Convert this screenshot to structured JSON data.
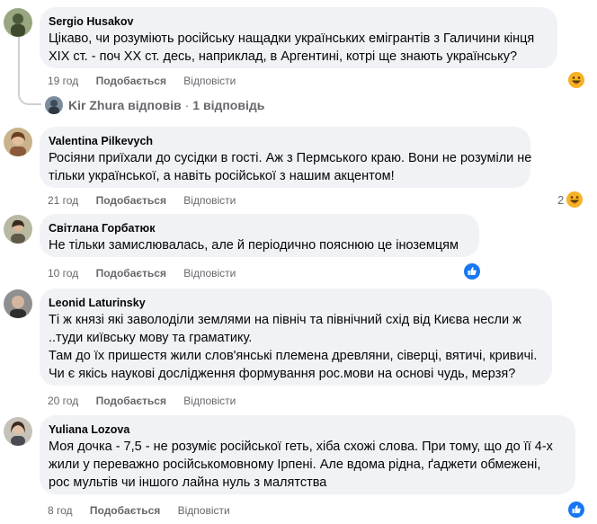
{
  "comments": [
    {
      "author": "Sergio Husakov",
      "lines": [
        "Цікаво, чи розуміють російську нащадки українських емігрантів з Галичини кінця",
        "XIX ст. - поч XX ст. десь, наприклад, в Аргентині, котрі ще знають українську?"
      ],
      "time": "19 год",
      "like": "Подобається",
      "reply": "Відповісти",
      "reactions": {
        "count": "",
        "icons": [
          "haha"
        ]
      }
    },
    {
      "author": "Valentina Pilkevych",
      "lines": [
        "Росіяни приїхали до сусідки в гості. Аж з Пермського краю. Вони не розуміли не",
        "тільки української, а навіть російської з нашим акцентом!"
      ],
      "time": "21 год",
      "like": "Подобається",
      "reply": "Відповісти",
      "reactions": {
        "count": "2",
        "icons": [
          "haha"
        ]
      }
    },
    {
      "author": "Світлана Горбатюк",
      "lines": [
        "Не тільки замислювалась, але й періодично пояснюю це іноземцям"
      ],
      "time": "10 год",
      "like": "Подобається",
      "reply": "Відповісти",
      "reactions": {
        "count": "",
        "icons": [
          "like"
        ]
      }
    },
    {
      "author": "Leonid Laturinsky",
      "lines": [
        "Ті ж князі які заволоділи землями на північ та північний схід від Києва несли ж",
        "..туди київську мову та граматику.",
        "Там до їх пришестя жили слов'янські племена древляни, сіверці, вятичі, кривичі.",
        "Чи є якісь наукові дослідження формування рос.мови на основі чудь, мерзя?"
      ],
      "time": "20 год",
      "like": "Подобається",
      "reply": "Відповісти",
      "reactions": {
        "count": "",
        "icons": []
      }
    },
    {
      "author": "Yuliana Lozova",
      "lines": [
        "Моя дочка - 7,5 - не розуміє російської геть, хіба схожі слова. При тому, що до її 4-х",
        "жили у переважно російськомовному Ірпені. Але вдома рідна, ґаджети обмежені,",
        "рос мультів чи іншого лайна нуль з малятства"
      ],
      "time": "8 год",
      "like": "Подобається",
      "reply": "Відповісти",
      "reactions": {
        "count": "",
        "icons": [
          "like"
        ]
      }
    }
  ],
  "thread": {
    "replier": "Kir Zhura",
    "replied": "відповів",
    "sep": "·",
    "count": "1 відповідь"
  },
  "colors": {
    "bubble": "#f0f2f5",
    "meta": "#65676b",
    "like_blue": "#1877f2",
    "haha_yellow": "#f7b125"
  }
}
